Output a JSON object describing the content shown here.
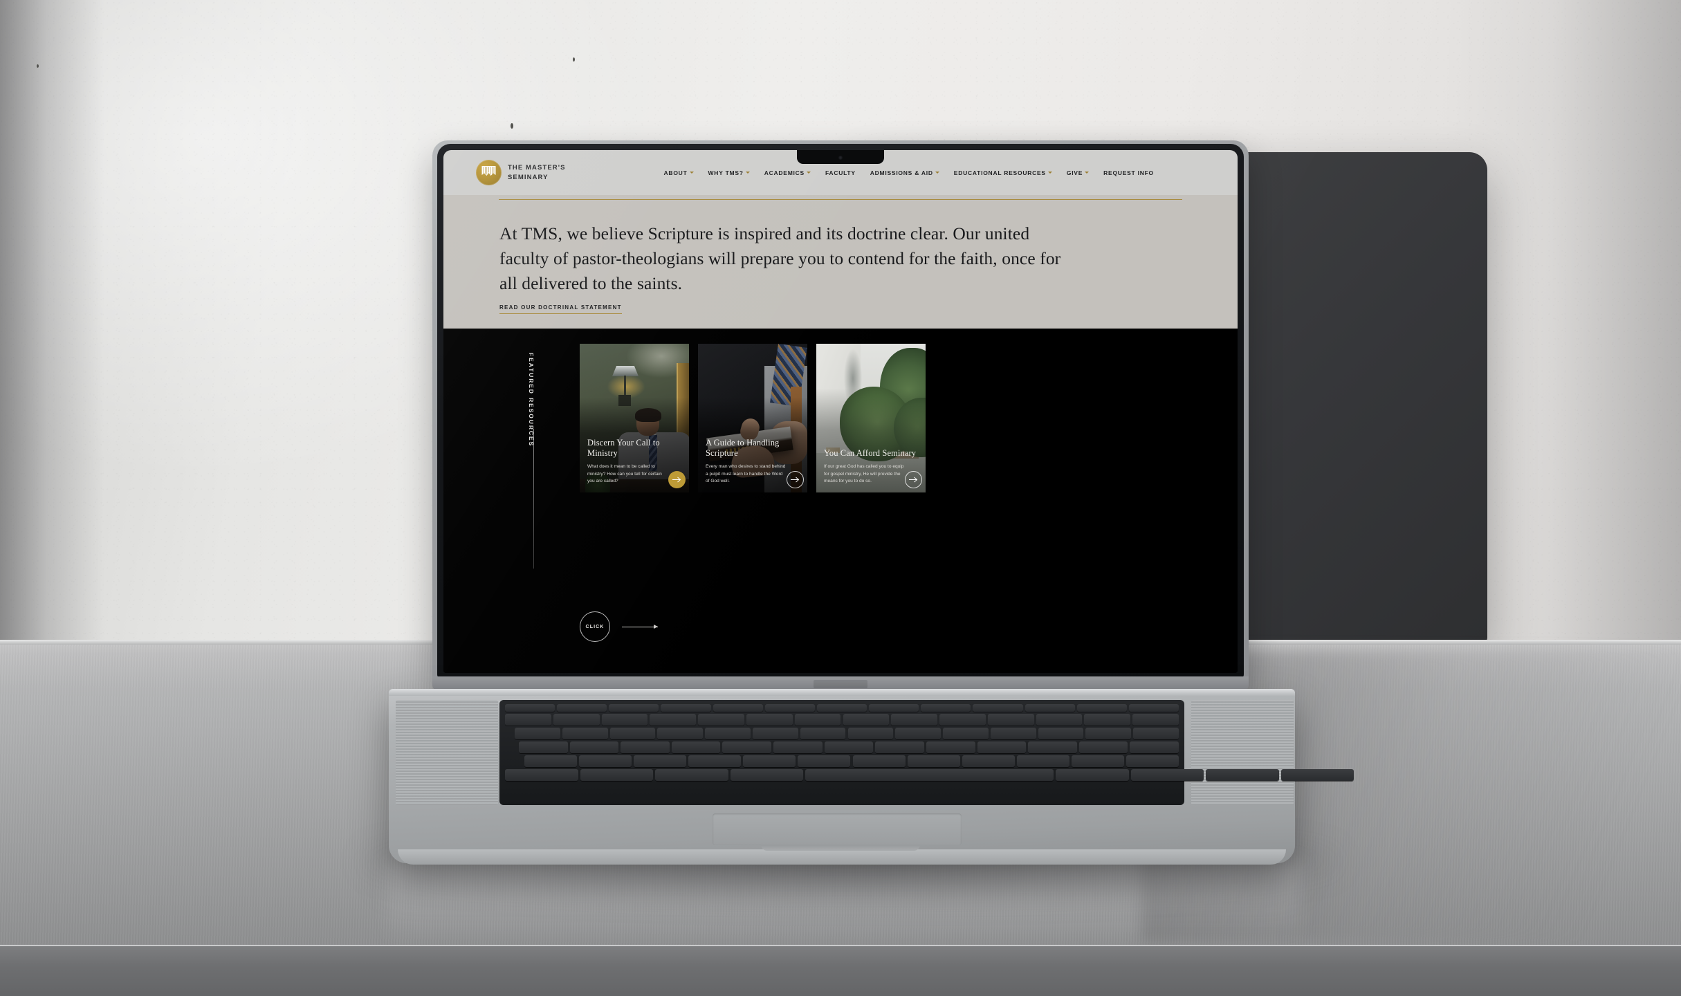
{
  "scene": {
    "device": "MacBook Pro laptop on a metal countertop against a white textured wall",
    "camera_icon": "camera-icon"
  },
  "site": {
    "nav": {
      "logo": {
        "mark": "curtain-emblem-icon",
        "line1": "THE MASTER'S",
        "line2": "SEMINARY"
      },
      "items": [
        {
          "label": "ABOUT",
          "has_caret": true
        },
        {
          "label": "WHY TMS?",
          "has_caret": true
        },
        {
          "label": "ACADEMICS",
          "has_caret": true
        },
        {
          "label": "FACULTY",
          "has_caret": false
        },
        {
          "label": "ADMISSIONS & AID",
          "has_caret": true
        },
        {
          "label": "EDUCATIONAL RESOURCES",
          "has_caret": true
        },
        {
          "label": "GIVE",
          "has_caret": true
        },
        {
          "label": "REQUEST INFO",
          "has_caret": false
        }
      ]
    },
    "hero": {
      "headline": "At TMS, we believe Scripture is inspired and its doctrine clear. Our united faculty of pastor-theologians will prepare you to contend for the faith, once for all delivered to the saints.",
      "cta_label": "READ OUR DOCTRINAL STATEMENT",
      "background_color": "#c4c1bc",
      "rule_color": "#a88b3e"
    },
    "featured": {
      "section_label": "FEATURED RESOURCES",
      "background_color": "#000000",
      "cards": [
        {
          "title": "Discern Your Call to Ministry",
          "description": "What does it mean to be called to ministry? How can you tell for certain you are called?",
          "arrow_icon": "arrow-right-icon",
          "arrow_style": "gold",
          "image_alt": "Man in a grey suit seated in a green-walled office beneath a wall lamp"
        },
        {
          "title": "A Guide to Handling Scripture",
          "description": "Every man who desires to stand behind a pulpit must learn to handle the Word of God well.",
          "arrow_icon": "arrow-right-icon",
          "arrow_style": "ghost",
          "image_alt": "Hands holding a leather-bound Bible against a dark background"
        },
        {
          "title": "You Can Afford Seminary",
          "description": "If our great God has called you to equip for gospel ministry, He will provide the means for you to do so.",
          "arrow_icon": "arrow-right-icon",
          "arrow_style": "ghost",
          "image_alt": "Sunlit campus courtyard with green trees"
        }
      ],
      "carousel": {
        "click_label": "CLICK",
        "arrow_icon": "arrow-right-icon"
      }
    },
    "colors": {
      "gold": "#bd9a35",
      "nav_background": "#cfcfcd",
      "dark": "#000000"
    }
  }
}
